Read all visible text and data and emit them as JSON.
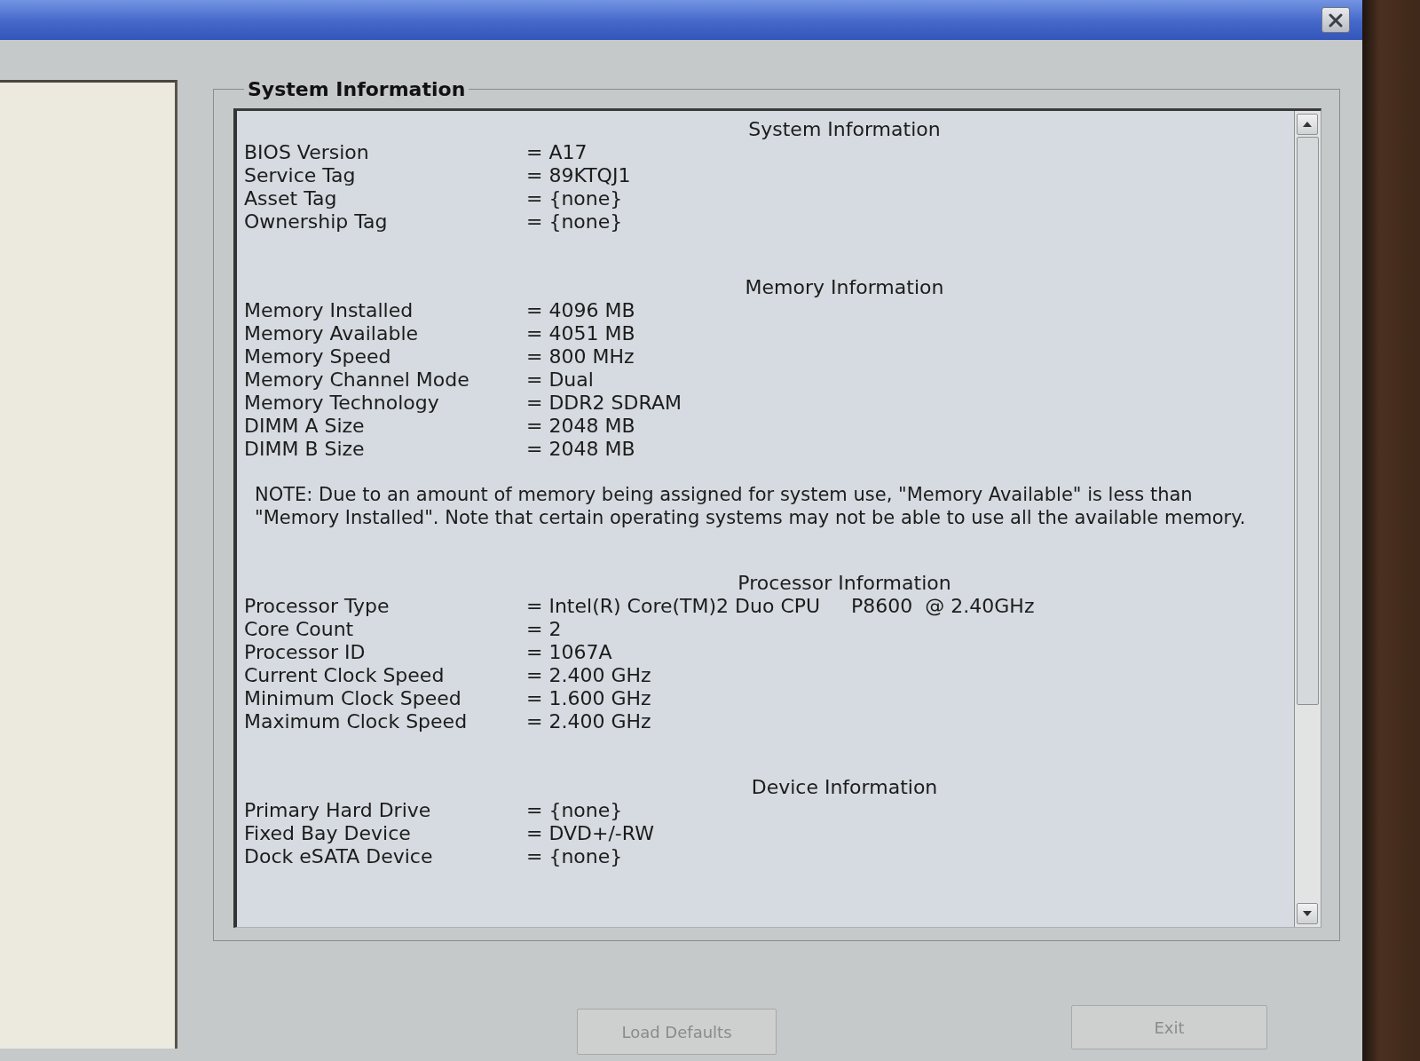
{
  "group_box": {
    "title": "System Information",
    "sections": [
      {
        "heading": "System Information",
        "rows": [
          {
            "label": "BIOS Version",
            "value": "= A17"
          },
          {
            "label": "Service Tag",
            "value": "= 89KTQJ1"
          },
          {
            "label": "Asset Tag",
            "value": "= {none}"
          },
          {
            "label": "Ownership Tag",
            "value": "= {none}"
          }
        ]
      },
      {
        "heading": "Memory Information",
        "rows": [
          {
            "label": "Memory Installed",
            "value": "= 4096 MB"
          },
          {
            "label": "Memory Available",
            "value": "= 4051 MB"
          },
          {
            "label": "Memory Speed",
            "value": "= 800 MHz"
          },
          {
            "label": "Memory Channel Mode",
            "value": "= Dual"
          },
          {
            "label": "Memory Technology",
            "value": "= DDR2 SDRAM"
          },
          {
            "label": "DIMM A Size",
            "value": "= 2048 MB"
          },
          {
            "label": "DIMM B Size",
            "value": "= 2048 MB"
          }
        ],
        "note": "NOTE: Due to an amount of memory being assigned for system use, \"Memory Available\" is less than \"Memory Installed\". Note that certain operating systems may not be able to use all the available memory."
      },
      {
        "heading": "Processor Information",
        "rows": [
          {
            "label": "Processor Type",
            "value": "= Intel(R) Core(TM)2 Duo CPU     P8600  @ 2.40GHz"
          },
          {
            "label": "Core Count",
            "value": "= 2"
          },
          {
            "label": "Processor ID",
            "value": "= 1067A"
          },
          {
            "label": "Current Clock Speed",
            "value": "= 2.400 GHz"
          },
          {
            "label": "Minimum Clock Speed",
            "value": "= 1.600 GHz"
          },
          {
            "label": "Maximum Clock Speed",
            "value": "= 2.400 GHz"
          }
        ]
      },
      {
        "heading": "Device Information",
        "rows": [
          {
            "label": "Primary Hard Drive",
            "value": "= {none}"
          },
          {
            "label": "Fixed Bay Device",
            "value": "= DVD+/-RW"
          },
          {
            "label": "Dock eSATA Device",
            "value": "= {none}"
          }
        ]
      }
    ]
  },
  "buttons": [
    "Load Defaults",
    "Exit"
  ]
}
